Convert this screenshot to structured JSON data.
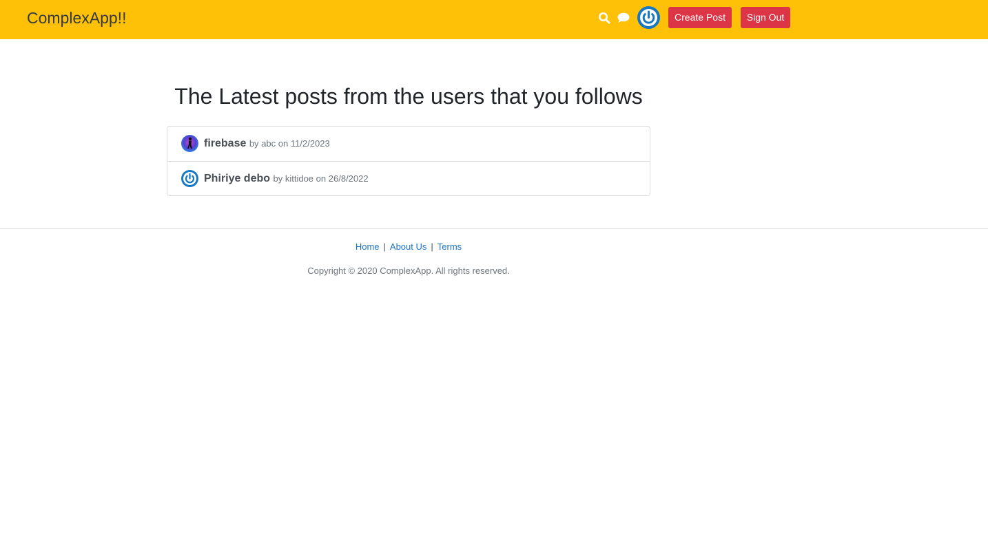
{
  "header": {
    "brand": "ComplexApp!!",
    "icons": [
      "search-icon",
      "chat-icon",
      "power-avatar-icon"
    ],
    "create_post_label": "Create Post",
    "sign_out_label": "Sign Out",
    "colors": {
      "header_bg": "#ffc107",
      "button_bg": "#dc3545",
      "avatar_blue": "#1677c2"
    }
  },
  "main": {
    "title": "The Latest posts from the users that you follows",
    "posts": [
      {
        "title": "firebase",
        "by_word": "by",
        "author": "abc",
        "on_word": "on",
        "date": "11/2/2023",
        "avatar": "galaxy-figure-avatar"
      },
      {
        "title": "Phiriye debo",
        "by_word": "by",
        "author": "kittidoe",
        "on_word": "on",
        "date": "26/8/2022",
        "avatar": "power-avatar-icon"
      }
    ]
  },
  "footer": {
    "links": [
      "Home",
      "About Us",
      "Terms"
    ],
    "separator": "|",
    "copyright": "Copyright © 2020 ComplexApp. All rights reserved."
  }
}
